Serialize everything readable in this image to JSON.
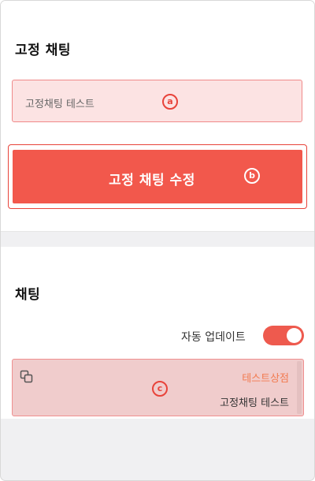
{
  "fixed_chat": {
    "title": "고정 채팅",
    "input_value": "고정채팅 테스트",
    "edit_button": "고정 채팅 수정"
  },
  "chat": {
    "title": "채팅",
    "auto_update_label": "자동 업데이트",
    "auto_update_on": true,
    "message": {
      "sender": "테스트상점",
      "text": "고정채팅 테스트"
    }
  },
  "markers": {
    "a": "a",
    "b": "b",
    "c": "c"
  },
  "colors": {
    "accent": "#f2584c",
    "highlight_bg": "#fce3e3",
    "sender": "#f27a4f"
  }
}
